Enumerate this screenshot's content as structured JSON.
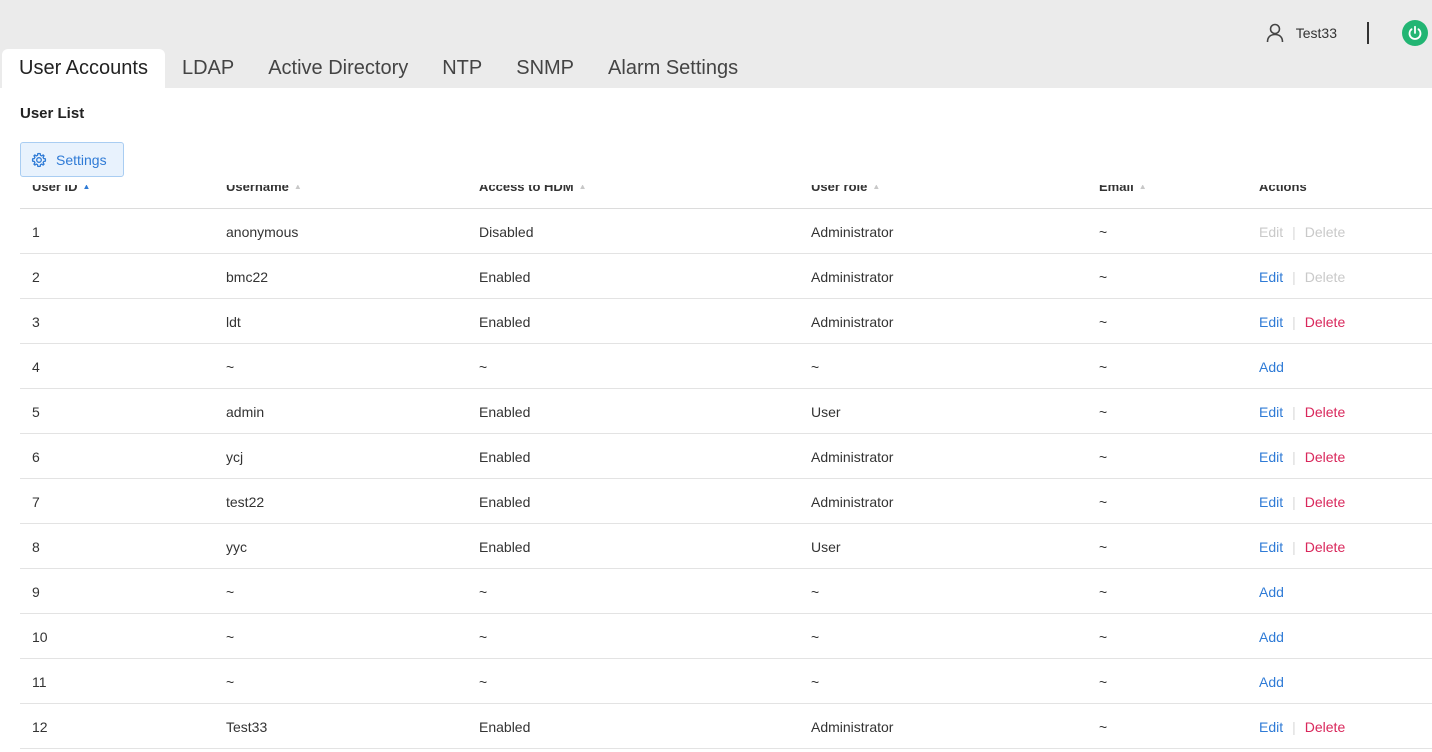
{
  "header": {
    "username": "Test33",
    "user_icon": "person-icon",
    "power_icon": "power-icon",
    "power_color": "#22b573"
  },
  "tabs": [
    {
      "label": "User Accounts",
      "active": true
    },
    {
      "label": "LDAP",
      "active": false
    },
    {
      "label": "Active Directory",
      "active": false
    },
    {
      "label": "NTP",
      "active": false
    },
    {
      "label": "SNMP",
      "active": false
    },
    {
      "label": "Alarm Settings",
      "active": false
    }
  ],
  "section": {
    "title": "User List",
    "settings_label": "Settings",
    "settings_icon": "gear-icon"
  },
  "table": {
    "columns": [
      "User ID",
      "Username",
      "Access to HDM",
      "User role",
      "Email",
      "Actions"
    ],
    "edit_label": "Edit",
    "delete_label": "Delete",
    "add_label": "Add",
    "rows": [
      {
        "id": "1",
        "username": "anonymous",
        "access": "Disabled",
        "role": "Administrator",
        "email": "~",
        "actions": "edit-delete",
        "edit_enabled": false,
        "delete_enabled": false
      },
      {
        "id": "2",
        "username": "bmc22",
        "access": "Enabled",
        "role": "Administrator",
        "email": "~",
        "actions": "edit-delete",
        "edit_enabled": true,
        "delete_enabled": false
      },
      {
        "id": "3",
        "username": "ldt",
        "access": "Enabled",
        "role": "Administrator",
        "email": "~",
        "actions": "edit-delete",
        "edit_enabled": true,
        "delete_enabled": true
      },
      {
        "id": "4",
        "username": "~",
        "access": "~",
        "role": "~",
        "email": "~",
        "actions": "add"
      },
      {
        "id": "5",
        "username": "admin",
        "access": "Enabled",
        "role": "User",
        "email": "~",
        "actions": "edit-delete",
        "edit_enabled": true,
        "delete_enabled": true
      },
      {
        "id": "6",
        "username": "ycj",
        "access": "Enabled",
        "role": "Administrator",
        "email": "~",
        "actions": "edit-delete",
        "edit_enabled": true,
        "delete_enabled": true
      },
      {
        "id": "7",
        "username": "test22",
        "access": "Enabled",
        "role": "Administrator",
        "email": "~",
        "actions": "edit-delete",
        "edit_enabled": true,
        "delete_enabled": true
      },
      {
        "id": "8",
        "username": "yyc",
        "access": "Enabled",
        "role": "User",
        "email": "~",
        "actions": "edit-delete",
        "edit_enabled": true,
        "delete_enabled": true
      },
      {
        "id": "9",
        "username": "~",
        "access": "~",
        "role": "~",
        "email": "~",
        "actions": "add"
      },
      {
        "id": "10",
        "username": "~",
        "access": "~",
        "role": "~",
        "email": "~",
        "actions": "add"
      },
      {
        "id": "11",
        "username": "~",
        "access": "~",
        "role": "~",
        "email": "~",
        "actions": "add"
      },
      {
        "id": "12",
        "username": "Test33",
        "access": "Enabled",
        "role": "Administrator",
        "email": "~",
        "actions": "edit-delete",
        "edit_enabled": true,
        "delete_enabled": true
      }
    ]
  }
}
